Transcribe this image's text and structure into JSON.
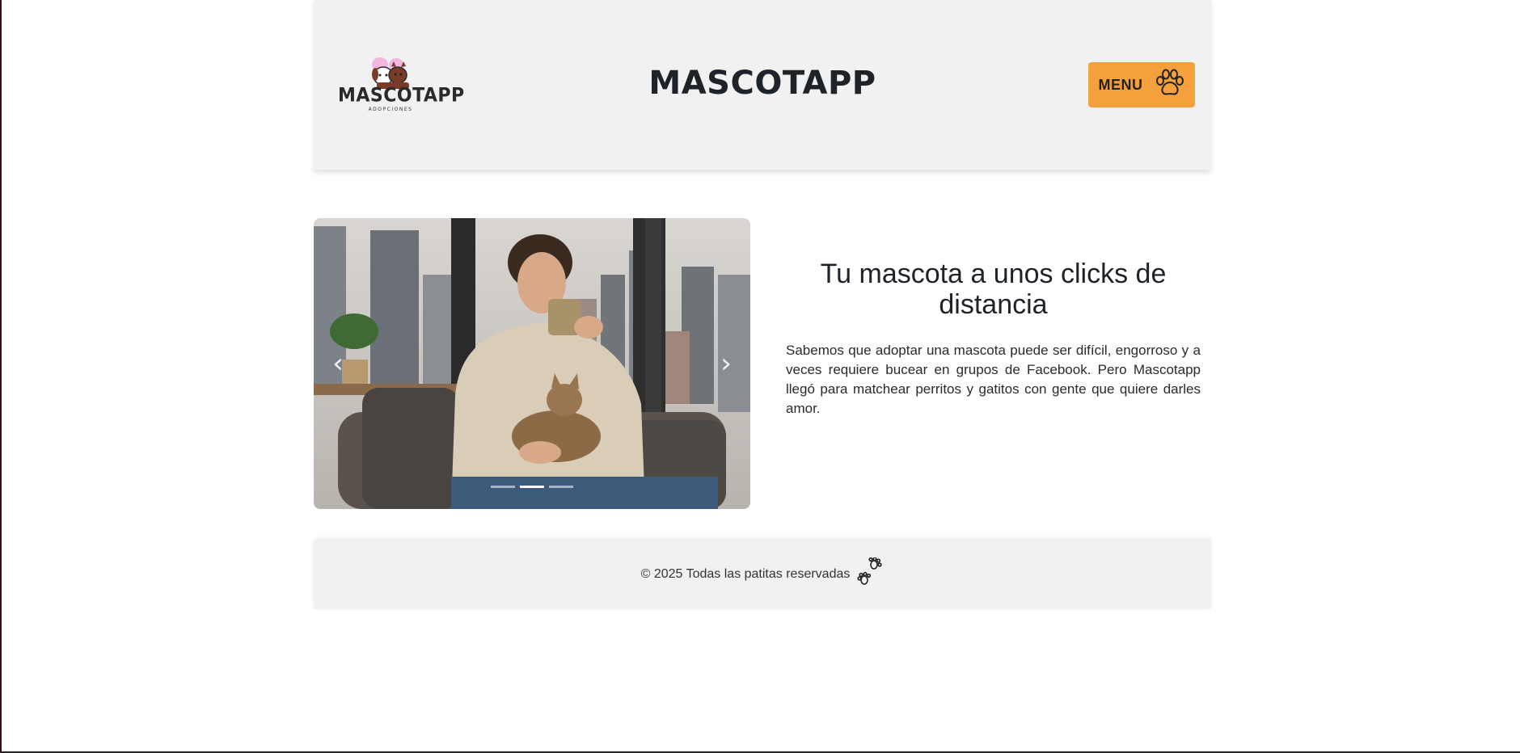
{
  "header": {
    "logo": {
      "text": "MASCOTAPP",
      "subtext": "ADOPCIONES"
    },
    "title": "MASCOTAPP",
    "menu_button": {
      "label": "MENU",
      "icon": "paw-icon"
    }
  },
  "hero": {
    "carousel": {
      "image_alt": "Man drinking from a mug with a cat on his lap by a window",
      "prev_icon": "chevron-left-icon",
      "next_icon": "chevron-right-icon",
      "indicator_count": 3,
      "active_index": 1
    },
    "title": "Tu mascota a unos clicks de distancia",
    "body": "Sabemos que adoptar una mascota puede ser difícil, engorroso y a veces requiere bucear en grupos de Facebook. Pero Mascotapp llegó para matchear perritos y gatitos con gente que quiere darles amor."
  },
  "footer": {
    "text": "© 2025 Todas las patitas reservadas",
    "icon": "paw-prints-icon"
  },
  "colors": {
    "accent": "#f4a03c",
    "panel_bg": "#f1f1f1",
    "text_dark": "#1e2329"
  }
}
